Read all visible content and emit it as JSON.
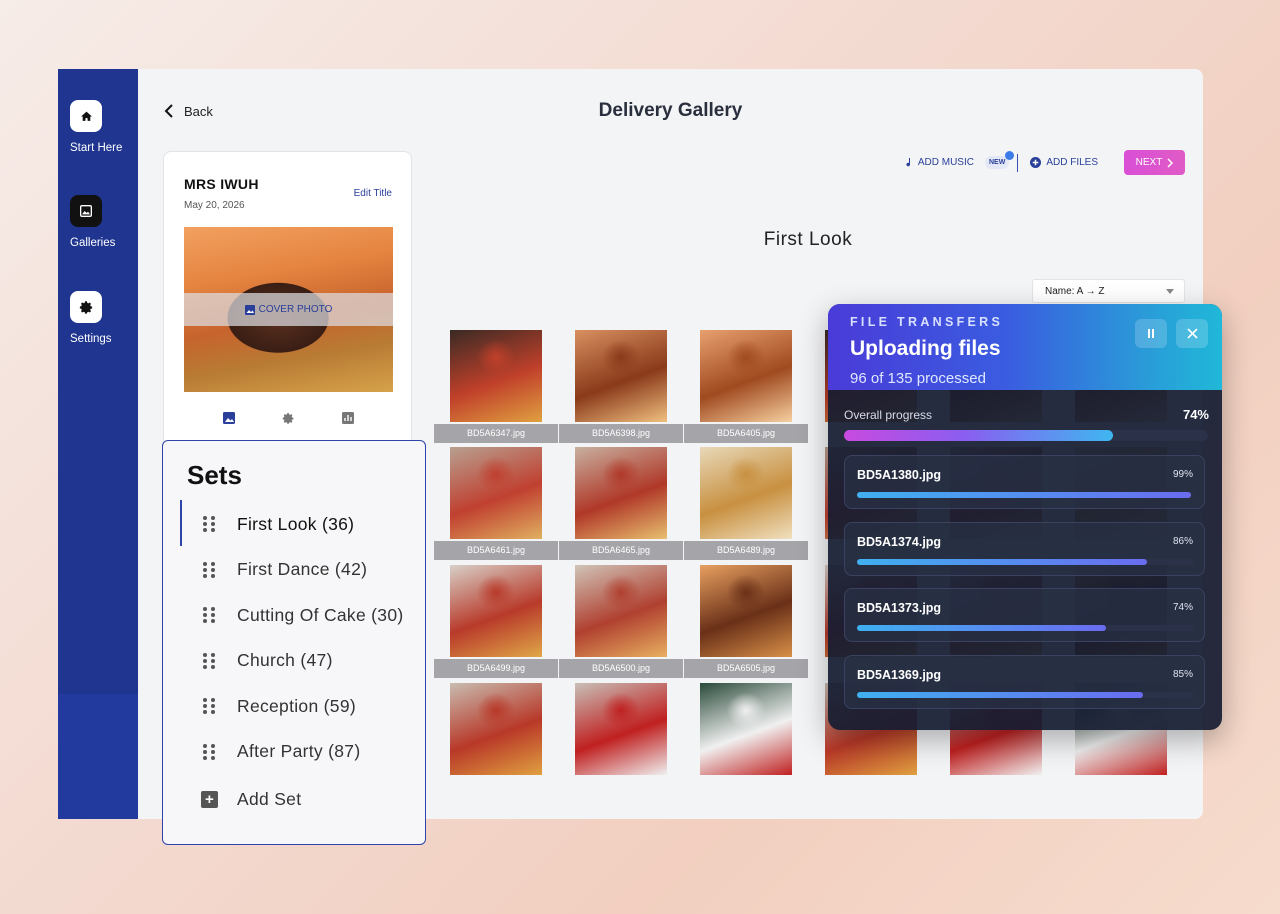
{
  "nav": {
    "items": [
      {
        "label": "Start Here",
        "icon": "home-icon"
      },
      {
        "label": "Galleries",
        "icon": "gallery-icon"
      },
      {
        "label": "Settings",
        "icon": "gear-icon"
      }
    ]
  },
  "header": {
    "back_label": "Back",
    "title": "Delivery Gallery"
  },
  "toolbar": {
    "add_music_label": "ADD MUSIC",
    "new_badge": "NEW",
    "add_files_label": "ADD FILES",
    "next_label": "NEXT"
  },
  "gallery_card": {
    "name": "MRS IWUH",
    "date": "May 20, 2026",
    "edit_label": "Edit Title",
    "cover_label": "COVER PHOTO"
  },
  "sets": {
    "title": "Sets",
    "items": [
      {
        "label": "First Look (36)",
        "active": true
      },
      {
        "label": "First Dance (42)",
        "active": false
      },
      {
        "label": "Cutting Of Cake (30)",
        "active": false
      },
      {
        "label": "Church (47)",
        "active": false
      },
      {
        "label": "Reception (59)",
        "active": false
      },
      {
        "label": "After Party (87)",
        "active": false
      }
    ],
    "add_label": "Add Set"
  },
  "content": {
    "set_title": "First Look",
    "sort_value": "Name: A → Z"
  },
  "photos": [
    "BD5A6347.jpg",
    "BD5A6398.jpg",
    "BD5A6405.jpg",
    "BD5A6461.jpg",
    "BD5A6465.jpg",
    "BD5A6489.jpg",
    "BD5A6499.jpg",
    "BD5A6500.jpg",
    "BD5A6505.jpg"
  ],
  "transfers": {
    "kicker": "FILE TRANSFERS",
    "title": "Uploading files",
    "subtitle": "96 of 135 processed",
    "overall_label": "Overall progress",
    "overall_pct_text": "74%",
    "overall_pct": 74,
    "files": [
      {
        "name": "BD5A1380.jpg",
        "pct_text": "99%",
        "pct": 99
      },
      {
        "name": "BD5A1374.jpg",
        "pct_text": "86%",
        "pct": 86
      },
      {
        "name": "BD5A1373.jpg",
        "pct_text": "74%",
        "pct": 74
      },
      {
        "name": "BD5A1369.jpg",
        "pct_text": "85%",
        "pct": 85
      }
    ]
  },
  "colors": {
    "sidebar": "#1f3590",
    "accent": "#2a3f99",
    "next_button": "#d94fd6"
  }
}
